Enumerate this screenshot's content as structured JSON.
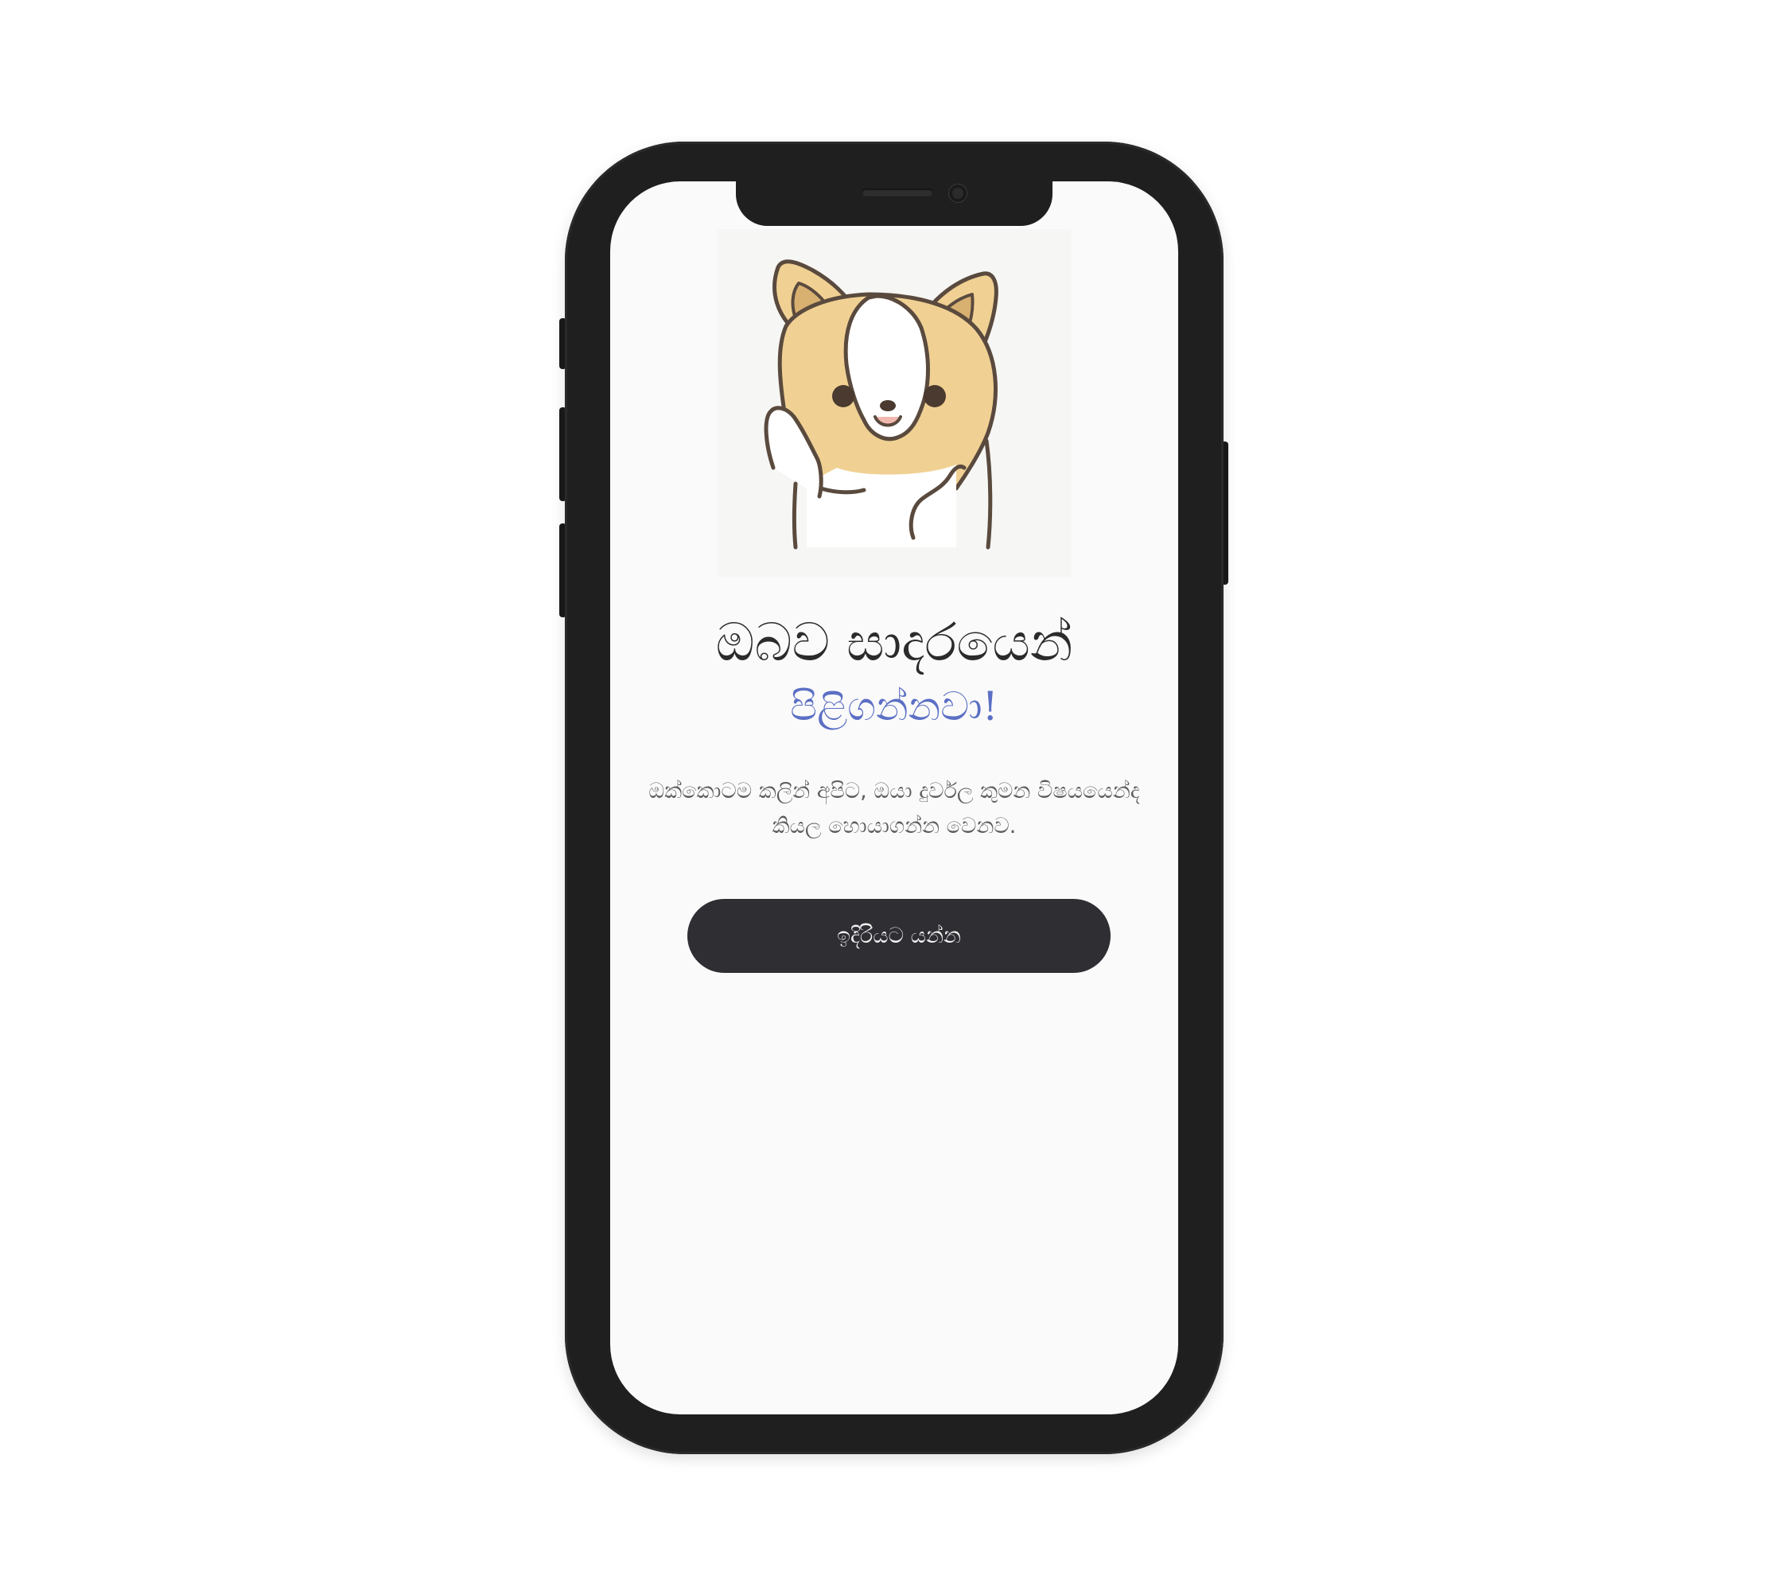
{
  "onboarding": {
    "title": "ඔබව සාදරයෙන්",
    "subtitle": "පිළිගන්නවා!",
    "description": "ඔක්කොටම කලින් අපිට, ඔයා දුර්වල කුමන විෂයයෙන්ද කියල හොයාගන්න වෙනව.",
    "cta_label": "ඉදිරියට යන්න",
    "illustration": "corgi-waving",
    "colors": {
      "accent": "#5b6fc4",
      "button": "#2e2e33",
      "screen": "#fafafa",
      "frame": "#1f1f1f"
    }
  }
}
